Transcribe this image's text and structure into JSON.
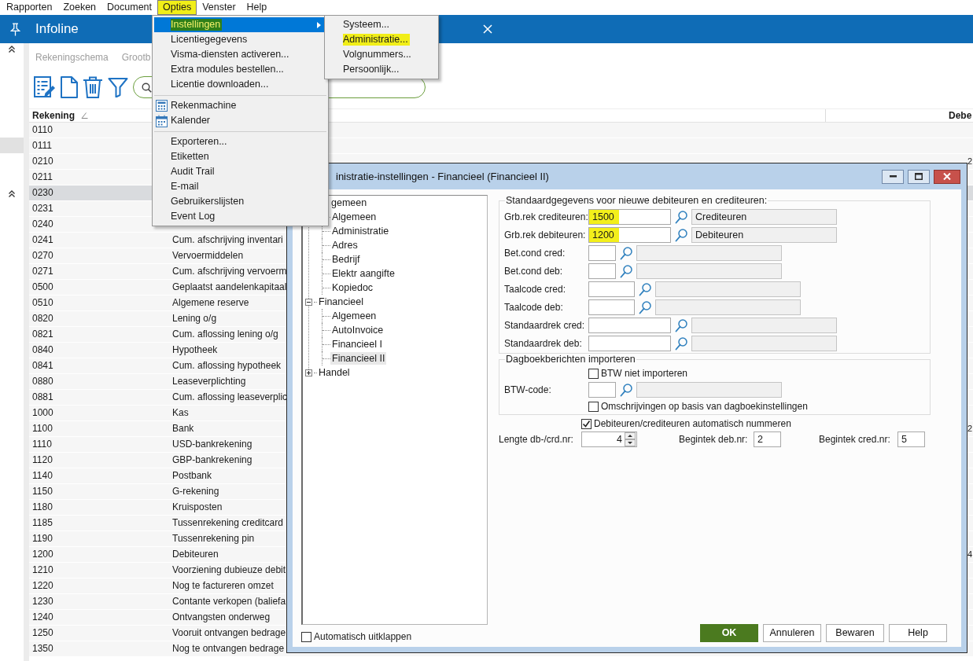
{
  "menubar": [
    {
      "label": "Rapporten",
      "selected": false,
      "highlighted": false
    },
    {
      "label": "Zoeken",
      "selected": false,
      "highlighted": false
    },
    {
      "label": "Document",
      "selected": false,
      "highlighted": false
    },
    {
      "label": "Opties",
      "selected": true,
      "highlighted": true
    },
    {
      "label": "Venster",
      "selected": false,
      "highlighted": false
    },
    {
      "label": "Help",
      "selected": false,
      "highlighted": false
    }
  ],
  "app": {
    "title": "Infoline"
  },
  "view_tabs": [
    {
      "label": "Rekeningschema"
    },
    {
      "label": "Grootb"
    }
  ],
  "table": {
    "columns": [
      {
        "label": "Rekening",
        "sorted": true
      },
      {
        "label": "Debe",
        "sorted": false
      }
    ],
    "rows": [
      {
        "account": "0110",
        "selected": false
      },
      {
        "account": "0111",
        "selected": false
      },
      {
        "account": "0210",
        "column_3": "2",
        "selected": false
      },
      {
        "account": "0211",
        "selected": false
      },
      {
        "account": "0230",
        "selected": true
      },
      {
        "account": "0231",
        "selected": false
      },
      {
        "account": "0240",
        "selected": false
      },
      {
        "account": "0241",
        "description": "Cum. afschrijving inventari",
        "selected": false
      },
      {
        "account": "0270",
        "description": "Vervoermiddelen",
        "selected": false
      },
      {
        "account": "0271",
        "description": "Cum. afschrijving vervoerm",
        "selected": false
      },
      {
        "account": "0500",
        "description": "Geplaatst aandelenkapitaal",
        "selected": false
      },
      {
        "account": "0510",
        "description": "Algemene reserve",
        "selected": false
      },
      {
        "account": "0820",
        "description": "Lening o/g",
        "selected": false
      },
      {
        "account": "0821",
        "description": "Cum. aflossing lening o/g",
        "selected": false
      },
      {
        "account": "0840",
        "description": "Hypotheek",
        "selected": false
      },
      {
        "account": "0841",
        "description": "Cum. aflossing hypotheek",
        "selected": false
      },
      {
        "account": "0880",
        "description": "Leaseverplichting",
        "selected": false
      },
      {
        "account": "0881",
        "description": "Cum. aflossing leaseverplic",
        "selected": false
      },
      {
        "account": "1000",
        "description": "Kas",
        "selected": false
      },
      {
        "account": "1100",
        "description": "Bank",
        "column_3": "2",
        "selected": false
      },
      {
        "account": "1110",
        "description": "USD-bankrekening",
        "selected": false
      },
      {
        "account": "1120",
        "description": "GBP-bankrekening",
        "selected": false
      },
      {
        "account": "1140",
        "description": "Postbank",
        "selected": false
      },
      {
        "account": "1150",
        "description": "G-rekening",
        "selected": false
      },
      {
        "account": "1180",
        "description": "Kruisposten",
        "selected": false
      },
      {
        "account": "1185",
        "description": "Tussenrekening creditcard",
        "selected": false
      },
      {
        "account": "1190",
        "description": "Tussenrekening pin",
        "selected": false
      },
      {
        "account": "1200",
        "description": "Debiteuren",
        "column_3": "4",
        "selected": false
      },
      {
        "account": "1210",
        "description": "Voorziening dubieuze debit",
        "selected": false
      },
      {
        "account": "1220",
        "description": "Nog te factureren omzet",
        "selected": false
      },
      {
        "account": "1230",
        "description": "Contante verkopen (baliefa",
        "selected": false
      },
      {
        "account": "1240",
        "description": "Ontvangsten onderweg",
        "selected": false
      },
      {
        "account": "1250",
        "description": "Vooruit ontvangen bedrage",
        "selected": false
      },
      {
        "account": "1350",
        "description": "Nog te ontvangen bedrage",
        "selected": false
      }
    ]
  },
  "options_menu": {
    "items": [
      {
        "kind": "item",
        "label": "Instellingen",
        "submenu": true,
        "selected": true,
        "highlighted": true
      },
      {
        "kind": "item",
        "label": "Licentiegegevens",
        "submenu": false,
        "selected": false,
        "highlighted": false
      },
      {
        "kind": "item",
        "label": "Visma-diensten activeren...",
        "submenu": false,
        "selected": false,
        "highlighted": false
      },
      {
        "kind": "item",
        "label": "Extra modules bestellen...",
        "submenu": false,
        "selected": false,
        "highlighted": false
      },
      {
        "kind": "item",
        "label": "Licentie downloaden...",
        "submenu": false,
        "selected": false,
        "highlighted": false
      },
      {
        "kind": "separator"
      },
      {
        "kind": "calculator",
        "label": "Rekenmachine",
        "submenu": false,
        "selected": false,
        "highlighted": false
      },
      {
        "kind": "calendar",
        "label": "Kalender",
        "submenu": false,
        "selected": false,
        "highlighted": false
      },
      {
        "kind": "separator"
      },
      {
        "kind": "item",
        "label": "Exporteren...",
        "submenu": false,
        "selected": false,
        "highlighted": false
      },
      {
        "kind": "item",
        "label": "Etiketten",
        "submenu": false,
        "selected": false,
        "highlighted": false
      },
      {
        "kind": "item",
        "label": "Audit Trail",
        "submenu": false,
        "selected": false,
        "highlighted": false
      },
      {
        "kind": "item",
        "label": "E-mail",
        "submenu": false,
        "selected": false,
        "highlighted": false
      },
      {
        "kind": "item",
        "label": "Gebruikerslijsten",
        "submenu": false,
        "selected": false,
        "highlighted": false
      },
      {
        "kind": "item",
        "label": "Event Log",
        "submenu": false,
        "selected": false,
        "highlighted": false
      }
    ]
  },
  "settings_submenu": {
    "items": [
      {
        "label": "Systeem...",
        "highlighted": false
      },
      {
        "label": "Administratie...",
        "highlighted": true
      },
      {
        "label": "Volgnummers...",
        "highlighted": false
      },
      {
        "label": "Persoonlijk...",
        "highlighted": false
      }
    ]
  },
  "dialog": {
    "title": "inistratie-instellingen - Financieel (Financieel II)",
    "tree": [
      {
        "label": "gemeen",
        "selected": false,
        "children": [
          {
            "label": "Algemeen",
            "selected": false
          },
          {
            "label": "Administratie",
            "selected": false
          },
          {
            "label": "Adres",
            "selected": false
          },
          {
            "label": "Bedrijf",
            "selected": false
          },
          {
            "label": "Elektr aangifte",
            "selected": false
          },
          {
            "label": "Kopiedoc",
            "selected": false
          }
        ]
      },
      {
        "label": "Financieel",
        "expanded": true,
        "selected": false,
        "children": [
          {
            "label": "Algemeen",
            "selected": false
          },
          {
            "label": "AutoInvoice",
            "selected": false
          },
          {
            "label": "Financieel I",
            "selected": false
          },
          {
            "label": "Financieel II",
            "selected": true
          }
        ]
      },
      {
        "label": "Handel",
        "expanded": false,
        "selected": false
      }
    ],
    "auto_expand": {
      "label": "Automatisch uitklappen",
      "checked": false
    },
    "groups": [
      {
        "title": "Standaardgegevens voor nieuwe debiteuren en crediteuren:",
        "rows": [
          {
            "kind": "account",
            "label": "Grb.rek crediteuren:",
            "value": "1500",
            "highlighted": true,
            "description": "Crediteuren"
          },
          {
            "kind": "account",
            "label": "Grb.rek debiteuren:",
            "value": "1200",
            "highlighted": true,
            "description": "Debiteuren"
          },
          {
            "kind": "condition",
            "label": "Bet.cond cred:",
            "highlighted": false
          },
          {
            "kind": "condition",
            "label": "Bet.cond deb:",
            "highlighted": false
          },
          {
            "kind": "language",
            "label": "Taalcode cred:",
            "highlighted": false
          },
          {
            "kind": "language",
            "label": "Taalcode deb:",
            "highlighted": false
          },
          {
            "kind": "account",
            "label": "Standaardrek cred:",
            "highlighted": false
          },
          {
            "kind": "account",
            "label": "Standaardrek deb:",
            "highlighted": false
          }
        ]
      },
      {
        "title": "Dagboekberichten importeren",
        "rows": [
          {
            "kind": "checkbox",
            "label": "BTW niet importeren",
            "checked": false
          },
          {
            "kind": "condition",
            "label": "BTW-code:",
            "highlighted": false
          },
          {
            "kind": "checkbox",
            "label": "Omschrijvingen op basis van dagboekinstellingen",
            "checked": false
          }
        ]
      }
    ],
    "auto_number": {
      "label": "Debiteuren/crediteuren automatisch nummeren",
      "checked": true
    },
    "number_fields": [
      {
        "kind": "spinner",
        "label": "Lengte db-/crd.nr:",
        "value": "4"
      },
      {
        "kind": "text",
        "label": "Begintek deb.nr:",
        "value": "2"
      },
      {
        "kind": "text",
        "label": "Begintek cred.nr:",
        "value": "5"
      }
    ],
    "buttons": [
      {
        "label": "OK",
        "primary": true
      },
      {
        "label": "Annuleren",
        "primary": false
      },
      {
        "label": "Bewaren",
        "primary": false
      },
      {
        "label": "Help",
        "primary": false
      }
    ]
  }
}
